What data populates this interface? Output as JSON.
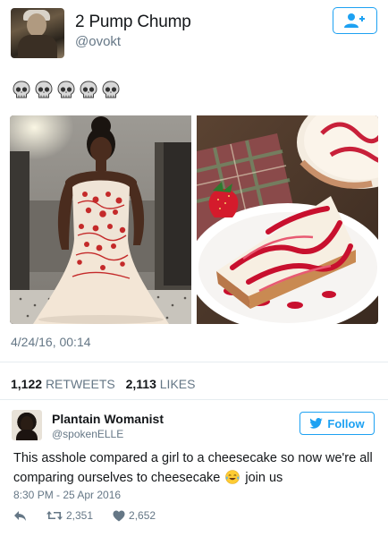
{
  "tweet": {
    "author_name": "2 Pump Chump",
    "author_handle": "@ovokt",
    "skull_emoji_count": 5,
    "timestamp": "4/24/16, 00:14",
    "retweets_count": "1,122",
    "retweets_label": "RETWEETS",
    "likes_count": "2,113",
    "likes_label": "LIKES",
    "images": [
      "photo-woman-in-dress",
      "photo-cheesecake-slice"
    ]
  },
  "reply": {
    "author_name": "Plantain Womanist",
    "author_handle": "@spokenELLE",
    "follow_label": "Follow",
    "text_before_emoji": "This asshole compared a girl to a cheesecake so now we're all comparing ourselves to cheesecake",
    "text_after_emoji": "join us",
    "timestamp": "8:30 PM - 25 Apr 2016",
    "retweets_count": "2,351",
    "likes_count": "2,652"
  },
  "colors": {
    "accent": "#1da1f2",
    "secondary_text": "#657786",
    "primary_text": "#14171a",
    "divider": "#e6ecf0"
  },
  "icons": [
    "follow-user-icon",
    "skull-icon",
    "twitter-bird-icon",
    "reply-icon",
    "retweet-icon",
    "heart-icon",
    "tears-of-joy-emoji"
  ]
}
